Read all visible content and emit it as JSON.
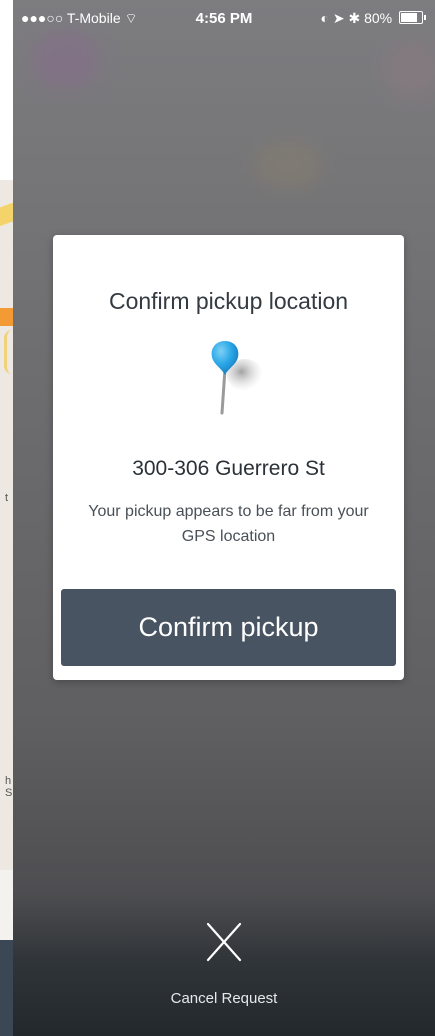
{
  "left_strip": {
    "labels": [
      "t",
      "h S"
    ]
  },
  "status_bar": {
    "carrier": "●●●○○ T-Mobile",
    "wifi_glyph": "⌔",
    "time": "4:56 PM",
    "right_icons": "◐ ➤ ✱",
    "battery": "80%",
    "battery_level": 0.8
  },
  "modal": {
    "title": "Confirm pickup location",
    "address": "300-306 Guerrero St",
    "message": "Your pickup appears to be far from your GPS location",
    "confirm_label": "Confirm pickup"
  },
  "cancel": {
    "label": "Cancel Request"
  },
  "colors": {
    "button_bg": "#485461",
    "pin_blue": "#2aa8e8",
    "overlay_dark": "#23282d"
  },
  "icons": {
    "pin": "map-pin-icon",
    "close": "close-icon",
    "battery": "battery-icon",
    "wifi": "wifi-icon"
  }
}
